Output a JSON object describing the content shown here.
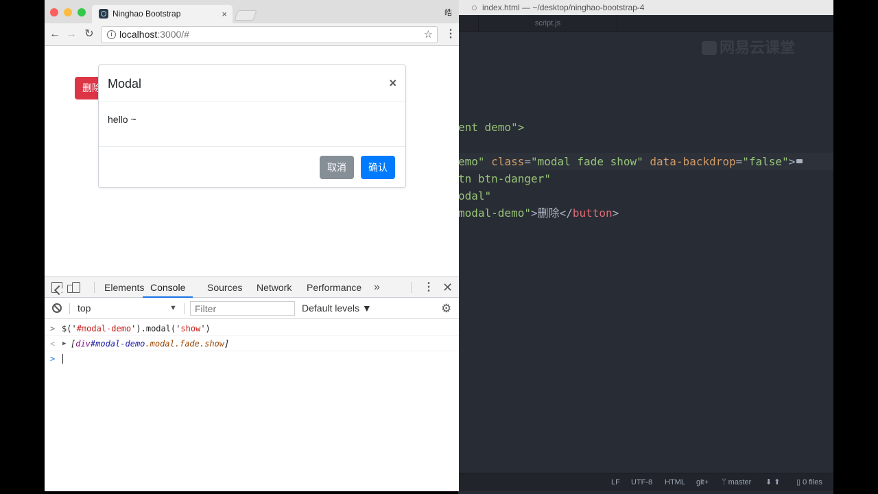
{
  "browser": {
    "tab_title": "Ninghao Bootstrap",
    "tab_close": "×",
    "profile_char": "皓",
    "url_host": "localhost",
    "url_rest": ":3000/#",
    "back": "←",
    "forward": "→",
    "reload": "↻",
    "star": "☆",
    "menu": "⋮"
  },
  "page": {
    "delete_button": "删除",
    "modal": {
      "title": "Modal",
      "close": "×",
      "body": "hello ~",
      "cancel": "取消",
      "confirm": "确认"
    }
  },
  "devtools": {
    "tabs": [
      "Elements",
      "Console",
      "Sources",
      "Network",
      "Performance"
    ],
    "active_tab": "Console",
    "more": "»",
    "kebab": "⋮",
    "close": "✕",
    "context": "top",
    "context_arrow": "▼",
    "filter_placeholder": "Filter",
    "levels": "Default levels ▼",
    "gear": "⚙",
    "input_prompt": ">",
    "output_prompt": "<",
    "command": {
      "pre": "$('",
      "selector": "#modal-demo",
      "mid": "').modal('",
      "arg": "show",
      "post": "')"
    },
    "result": {
      "toggle": "▶",
      "open": "[",
      "tag": "div",
      "id": "#modal-demo",
      "classes": ".modal.fade.show",
      "close": "]"
    }
  },
  "editor": {
    "title": "index.html — ~/desktop/ninghao-bootstrap-4",
    "tab_script": "script.js",
    "watermark": "网易云课堂",
    "status": {
      "line_ending": "LF",
      "encoding": "UTF-8",
      "grammar": "HTML",
      "git": "git+",
      "branch": "master",
      "arrows": "⬇ ⬆",
      "files": "0 files"
    },
    "code": {
      "l1": "ent demo\">",
      "l2a": "emo\"",
      "l2b": " ",
      "l2c": "class",
      "l2d": "=",
      "l2e": "\"modal fade show\"",
      "l2f": " ",
      "l2g": "data-backdrop",
      "l2h": "=",
      "l2i": "\"false\"",
      "l2j": ">",
      "l3": "tn btn-danger\"",
      "l4": "odal\"",
      "l5a": "modal-demo\"",
      "l5b": ">删除</",
      "l5c": "button",
      "l5d": ">"
    }
  },
  "colors": {
    "danger": "#dc3545",
    "primary": "#007bff",
    "secondary": "#868e96",
    "editor_bg": "#282c34"
  }
}
